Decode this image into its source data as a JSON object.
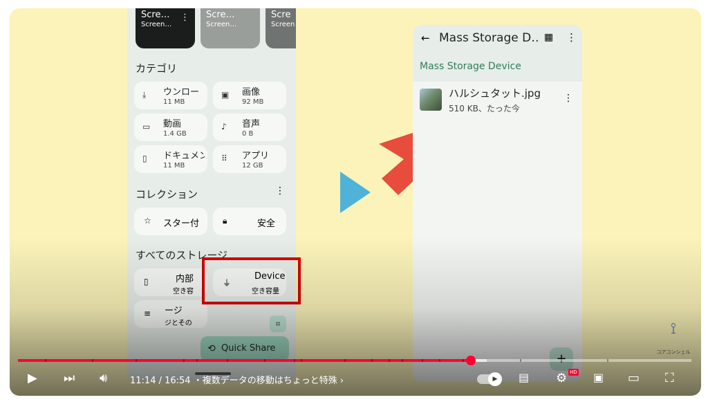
{
  "left_phone": {
    "thumbs": [
      {
        "title": "Scre…",
        "sub": "Screen…"
      },
      {
        "title": "Scre…",
        "sub": "Screen…"
      },
      {
        "title": "Scre",
        "sub": "Screen"
      }
    ],
    "categories_title": "カテゴリ",
    "categories": [
      {
        "name": "ウンロー",
        "size": "11 MB",
        "icon": "download-icon"
      },
      {
        "name": "画像",
        "size": "92 MB",
        "icon": "image-icon"
      },
      {
        "name": "動画",
        "size": "1.4 GB",
        "icon": "video-icon"
      },
      {
        "name": "音声",
        "size": "0 B",
        "icon": "music-icon"
      },
      {
        "name": "ドキュメン",
        "size": "11 MB",
        "icon": "document-icon"
      },
      {
        "name": "アプリ",
        "size": "12 GB",
        "icon": "apps-grid-icon"
      }
    ],
    "collections_title": "コレクション",
    "collections": [
      {
        "name": "スター付",
        "icon": "star-icon"
      },
      {
        "name": "安全",
        "icon": "lock-icon"
      }
    ],
    "storage_title": "すべてのストレージ",
    "storages": [
      {
        "name": "内部",
        "sub": "空き容",
        "icon": "phone-icon"
      },
      {
        "name": "Device",
        "sub": "空き容量",
        "icon": "usb-icon"
      },
      {
        "name": "ージ",
        "sub": "ジとその",
        "icon": "list-icon"
      }
    ],
    "quick_share": "Quick Share"
  },
  "right_phone": {
    "title": "Mass Storage D…",
    "breadcrumb": "Mass Storage Device",
    "file": {
      "name": "ハルシュタット.jpg",
      "meta": "510 KB、たった今"
    }
  },
  "logo_text": "コアコンシェル",
  "player": {
    "time": "11:14 / 16:54 ・複数データの移動はちょっと特殊 ›",
    "progress_fraction": 0.672,
    "chapter_marks": [
      0.04,
      0.11,
      0.175,
      0.245,
      0.265,
      0.31,
      0.365,
      0.41,
      0.42,
      0.485,
      0.525,
      0.55,
      0.57,
      0.6,
      0.625,
      0.66,
      0.745,
      0.875
    ],
    "hd_badge": "HD"
  },
  "colors": {
    "progress": "#ff0033",
    "arrow": "#e74c3c",
    "play_triangle": "#4fb3d9",
    "highlight_box": "#d80000"
  }
}
